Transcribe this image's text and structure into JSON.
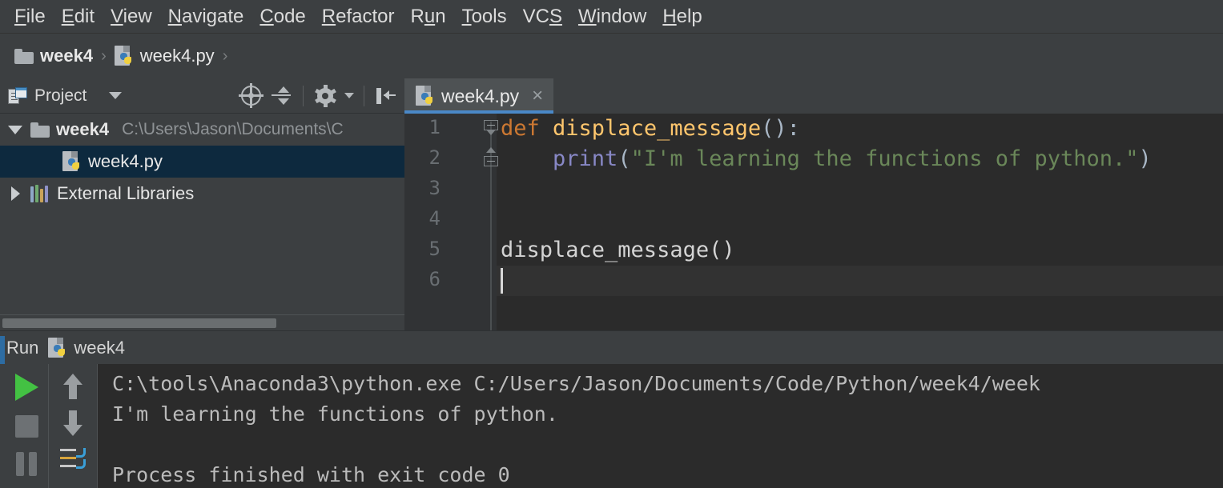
{
  "menu": {
    "items": [
      {
        "label": "File",
        "mnemonic": "F"
      },
      {
        "label": "Edit",
        "mnemonic": "E"
      },
      {
        "label": "View",
        "mnemonic": "V"
      },
      {
        "label": "Navigate",
        "mnemonic": "N"
      },
      {
        "label": "Code",
        "mnemonic": "C"
      },
      {
        "label": "Refactor",
        "mnemonic": "R"
      },
      {
        "label": "Run",
        "mnemonic": "u"
      },
      {
        "label": "Tools",
        "mnemonic": "T"
      },
      {
        "label": "VCS",
        "mnemonic": "S"
      },
      {
        "label": "Window",
        "mnemonic": "W"
      },
      {
        "label": "Help",
        "mnemonic": "H"
      }
    ]
  },
  "breadcrumb": {
    "separator": "›",
    "items": [
      {
        "label": "week4",
        "icon": "folder-icon"
      },
      {
        "label": "week4.py",
        "icon": "python-file-icon"
      }
    ]
  },
  "project_panel": {
    "title": "Project",
    "icon": "project-icon",
    "dropdown_icon": "chevron-down-icon",
    "actions": [
      {
        "name": "locate-in-tree-icon"
      },
      {
        "name": "collapse-all-icon"
      },
      {
        "name": "settings-gear-icon"
      },
      {
        "name": "hide-panel-icon"
      }
    ],
    "tree": [
      {
        "label": "week4",
        "path": "C:\\Users\\Jason\\Documents\\C",
        "expanded": true,
        "selected": false,
        "icon": "folder-icon",
        "indent": 0
      },
      {
        "label": "week4.py",
        "path": "",
        "expanded": null,
        "selected": true,
        "icon": "python-file-icon",
        "indent": 1
      },
      {
        "label": "External Libraries",
        "path": "",
        "expanded": false,
        "selected": false,
        "icon": "libraries-icon",
        "indent": 0
      }
    ]
  },
  "editor": {
    "tabs": [
      {
        "label": "week4.py",
        "icon": "python-file-icon",
        "active": true,
        "close_icon": "×"
      }
    ],
    "line_numbers": [
      "1",
      "2",
      "3",
      "4",
      "5",
      "6"
    ],
    "caret_line": 6,
    "lines": [
      {
        "number": "1",
        "tokens": [
          {
            "text": "def ",
            "type": "keyword"
          },
          {
            "text": "displace_message",
            "type": "function"
          },
          {
            "text": "():",
            "type": "plain"
          }
        ]
      },
      {
        "number": "2",
        "tokens": [
          {
            "text": "    ",
            "type": "plain"
          },
          {
            "text": "print",
            "type": "builtin"
          },
          {
            "text": "(",
            "type": "plain"
          },
          {
            "text": "\"I'm learning the functions of python.\"",
            "type": "string"
          },
          {
            "text": ")",
            "type": "plain"
          }
        ]
      },
      {
        "number": "3",
        "tokens": []
      },
      {
        "number": "4",
        "tokens": []
      },
      {
        "number": "5",
        "tokens": [
          {
            "text": "displace_message()",
            "type": "plain-white"
          }
        ]
      },
      {
        "number": "6",
        "tokens": []
      }
    ],
    "colors": {
      "background": "#2b2b2b",
      "gutter": "#313335",
      "keyword": "#cc7832",
      "function": "#ffc66d",
      "builtin": "#8888c6",
      "string": "#6a8759",
      "plain": "#a9b7c6",
      "tab_active_underline": "#4a88c7"
    }
  },
  "run_panel": {
    "title": "Run",
    "config_name": "week4",
    "config_icon": "python-file-icon",
    "toolbar_left": [
      {
        "name": "rerun-play-icon",
        "color": "#43c143"
      },
      {
        "name": "stop-icon",
        "color": "#6d7174"
      },
      {
        "name": "pause-icon",
        "color": "#6d7174"
      }
    ],
    "toolbar_right": [
      {
        "name": "up-arrow-icon",
        "color": "#9a9ea1"
      },
      {
        "name": "down-arrow-icon",
        "color": "#9a9ea1"
      },
      {
        "name": "soft-wrap-icon",
        "color": "#3a9fd8"
      }
    ],
    "console": [
      "C:\\tools\\Anaconda3\\python.exe C:/Users/Jason/Documents/Code/Python/week4/week",
      "I'm learning the functions of python.",
      "",
      "Process finished with exit code 0"
    ]
  },
  "theme": {
    "chrome_background": "#3c3f41",
    "panel_background": "#2b2b2b",
    "selection_blue": "#0d293e",
    "accent_blue": "#2d6ca2"
  }
}
